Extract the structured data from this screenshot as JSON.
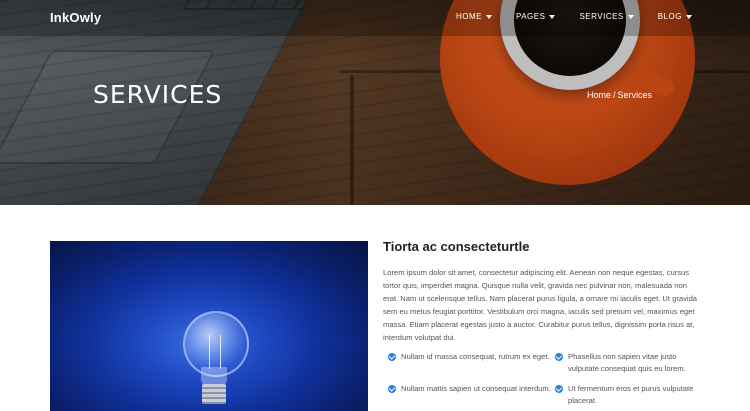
{
  "header": {
    "brand": "InkOwly",
    "menu": [
      {
        "label": "HOME"
      },
      {
        "label": "PAGES"
      },
      {
        "label": "SERVICES"
      },
      {
        "label": "BLOG"
      }
    ]
  },
  "hero": {
    "title": "SERVICES",
    "breadcrumb": {
      "home": "Home",
      "separator": "/",
      "current": "Services"
    }
  },
  "main": {
    "heading": "Tiorta ac consecteturtle",
    "paragraph": "Lorem ipsum dolor sit amet, consectetur adipiscing elit. Aenean non neque egestas, cursus tortor quis, imperdiet magna. Quisque nulla velit, gravida nec pulvinar non, malesuada non erat. Nam ut scelerisque tellus. Nam placerat purus ligula, a ornare mi iaculis eget. Ut gravida sem eu metus feugiat porttitor. Vestibulum orci magna, iaculis sed pretium vel, maximus eget massa. Etiam placerat egestas justo a auctor. Curabitur purus tellus, dignissim porta risus at, interdum volutpat dui.",
    "features": [
      "Nullam id massa consequat, rutrum ex eget.",
      "Phasellus non sapien vitae justo vulputate consequat quis eu lorem.",
      "Nullam mattis sapien ut consequat interdum.",
      "Ut fermentum eros et purus vulputate placerat."
    ]
  },
  "colors": {
    "accent": "#2f7fe0",
    "saucer": "#f05a1a"
  },
  "icons": {
    "caret": "chevron-down-icon",
    "check": "check-circle-icon"
  }
}
